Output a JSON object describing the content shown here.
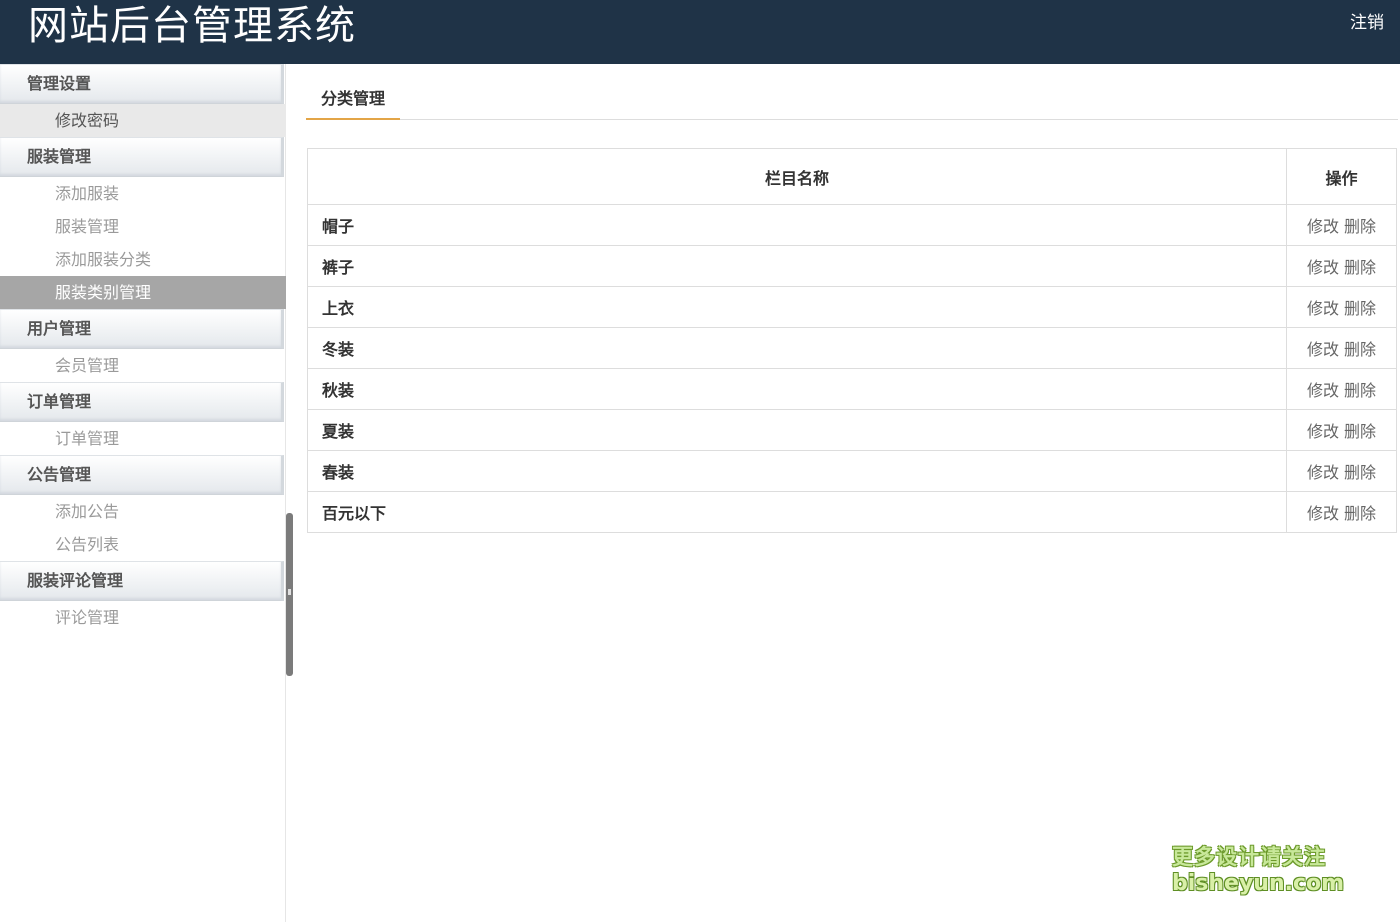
{
  "header": {
    "title": "网站后台管理系统",
    "logout_label": "注销"
  },
  "sidebar": {
    "groups": [
      {
        "label": "管理设置",
        "items": [
          {
            "label": "修改密码"
          }
        ]
      },
      {
        "label": "服装管理",
        "items": [
          {
            "label": "添加服装"
          },
          {
            "label": "服装管理"
          },
          {
            "label": "添加服装分类"
          },
          {
            "label": "服装类别管理"
          }
        ]
      },
      {
        "label": "用户管理",
        "items": [
          {
            "label": "会员管理"
          }
        ]
      },
      {
        "label": "订单管理",
        "items": [
          {
            "label": "订单管理"
          }
        ]
      },
      {
        "label": "公告管理",
        "items": [
          {
            "label": "添加公告"
          },
          {
            "label": "公告列表"
          }
        ]
      },
      {
        "label": "服装评论管理",
        "items": [
          {
            "label": "评论管理"
          }
        ]
      }
    ]
  },
  "main": {
    "tab_label": "分类管理",
    "table": {
      "headers": {
        "name": "栏目名称",
        "ops": "操作"
      },
      "edit_label": "修改",
      "delete_label": "删除",
      "rows": [
        {
          "name": "帽子"
        },
        {
          "name": "裤子"
        },
        {
          "name": "上衣"
        },
        {
          "name": "冬装"
        },
        {
          "name": "秋装"
        },
        {
          "name": "夏装"
        },
        {
          "name": "春装"
        },
        {
          "name": "百元以下"
        }
      ]
    }
  },
  "watermark": {
    "line1": "更多设计请关注",
    "line2": "bisheyun.com"
  },
  "colors": {
    "header_bg": "#1f3347",
    "active_item_bg": "#a6a6a6",
    "tab_accent": "#e3a547"
  }
}
